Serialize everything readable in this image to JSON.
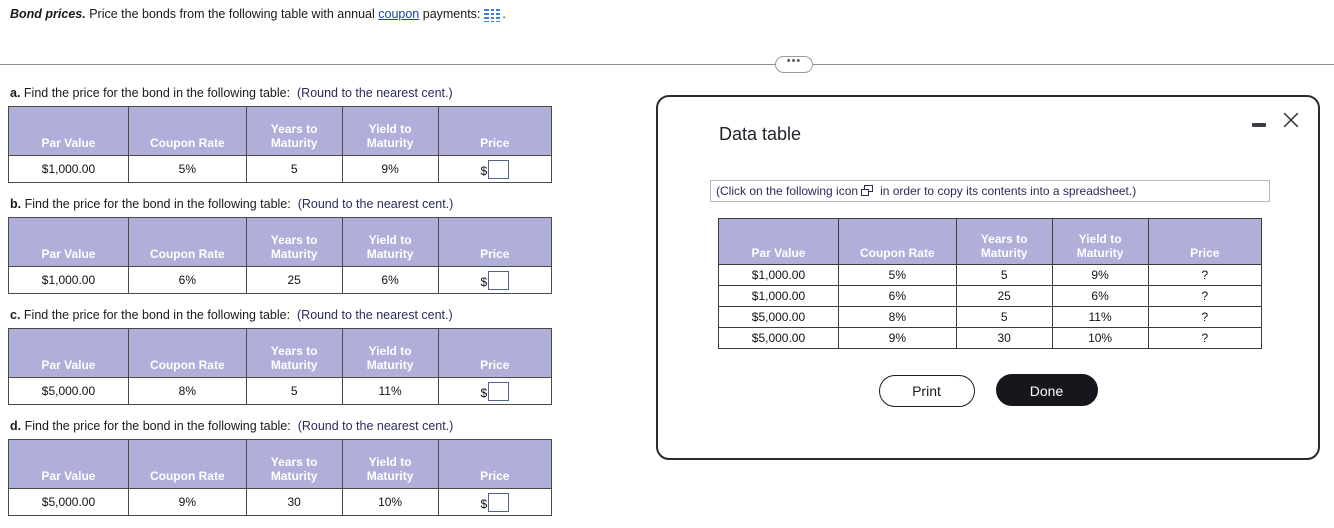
{
  "prompt": {
    "lead": "Bond prices.",
    "text_before_link": " Price the bonds from the following table with annual ",
    "link_text": "coupon",
    "text_after_link": " payments:",
    "trailing": ".",
    "icon": "table-grid-icon"
  },
  "divider": {
    "pill_label": "•••"
  },
  "columns": [
    "Par Value",
    "Coupon Rate",
    "Years to Maturity",
    "Yield to Maturity",
    "Price"
  ],
  "columns_lines": [
    [
      "Par Value"
    ],
    [
      "Coupon Rate"
    ],
    [
      "Years to",
      "Maturity"
    ],
    [
      "Yield to",
      "Maturity"
    ],
    [
      "Price"
    ]
  ],
  "questions": [
    {
      "label": "a.",
      "text": " Find the price for the bond in the following table:",
      "round_note": "(Round to the nearest cent.)",
      "row": {
        "par_value": "$1,000.00",
        "coupon_rate": "5%",
        "years_to_maturity": "5",
        "yield_to_maturity": "9%",
        "price_prefix": "$",
        "price_value": ""
      }
    },
    {
      "label": "b.",
      "text": " Find the price for the bond in the following table:",
      "round_note": "(Round to the nearest cent.)",
      "row": {
        "par_value": "$1,000.00",
        "coupon_rate": "6%",
        "years_to_maturity": "25",
        "yield_to_maturity": "6%",
        "price_prefix": "$",
        "price_value": ""
      }
    },
    {
      "label": "c.",
      "text": " Find the price for the bond in the following table:",
      "round_note": "(Round to the nearest cent.)",
      "row": {
        "par_value": "$5,000.00",
        "coupon_rate": "8%",
        "years_to_maturity": "5",
        "yield_to_maturity": "11%",
        "price_prefix": "$",
        "price_value": ""
      }
    },
    {
      "label": "d.",
      "text": " Find the price for the bond in the following table:",
      "round_note": "(Round to the nearest cent.)",
      "row": {
        "par_value": "$5,000.00",
        "coupon_rate": "9%",
        "years_to_maturity": "30",
        "yield_to_maturity": "10%",
        "price_prefix": "$",
        "price_value": ""
      }
    }
  ],
  "dialog": {
    "title": "Data table",
    "minimize_icon": "minimize-icon",
    "close_icon": "close-icon",
    "hint_prefix": "(Click on the following icon",
    "hint_icon": "copy-icon",
    "hint_suffix": "in order to copy its contents into a spreadsheet.)",
    "table": {
      "headers_lines": [
        [
          "Par Value"
        ],
        [
          "Coupon Rate"
        ],
        [
          "Years to",
          "Maturity"
        ],
        [
          "Yield to",
          "Maturity"
        ],
        [
          "Price"
        ]
      ],
      "rows": [
        {
          "par_value": "$1,000.00",
          "coupon_rate": "5%",
          "years_to_maturity": "5",
          "yield_to_maturity": "9%",
          "price": "?"
        },
        {
          "par_value": "$1,000.00",
          "coupon_rate": "6%",
          "years_to_maturity": "25",
          "yield_to_maturity": "6%",
          "price": "?"
        },
        {
          "par_value": "$5,000.00",
          "coupon_rate": "8%",
          "years_to_maturity": "5",
          "yield_to_maturity": "11%",
          "price": "?"
        },
        {
          "par_value": "$5,000.00",
          "coupon_rate": "9%",
          "years_to_maturity": "30",
          "yield_to_maturity": "10%",
          "price": "?"
        }
      ]
    },
    "print_label": "Print",
    "done_label": "Done"
  },
  "colors": {
    "table_header_bg": "#afafd9",
    "link": "#1a3fb0",
    "note_text": "#2b2b5e",
    "dialog_border": "#2a2a33",
    "done_bg": "#16161d",
    "grid_icon": "#3f7fd6"
  }
}
